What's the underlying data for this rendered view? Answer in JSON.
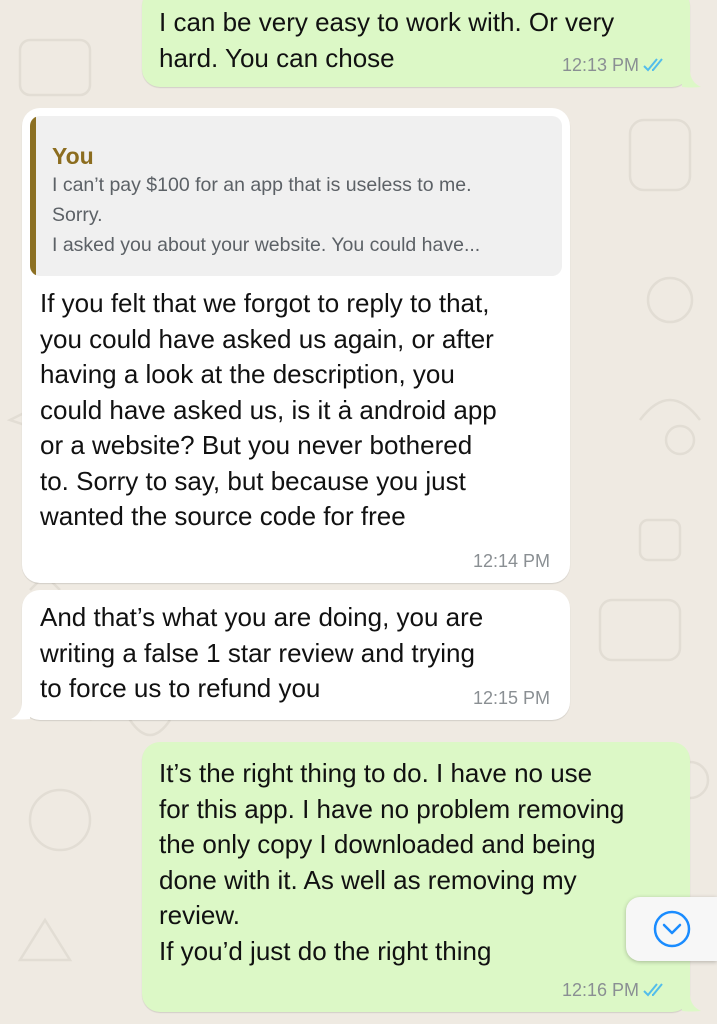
{
  "messages": [
    {
      "direction": "outgoing",
      "text": "I can be very easy to work with. Or very\nhard. You can chose",
      "time": "12:13 PM",
      "status": "read"
    },
    {
      "direction": "incoming",
      "quote": {
        "author": "You",
        "text": "I can’t pay $100 for an app that is useless to me.\nSorry.\nI asked you about your website. You could have..."
      },
      "text": "If you felt that we forgot to reply to that,\nyou could have asked us again, or after\nhaving a look at the description, you\ncould have asked us, is it ȧ android app\nor a website? But you never bothered\nto. Sorry to say, but because you just\nwanted the source code for free",
      "time": "12:14 PM"
    },
    {
      "direction": "incoming",
      "text": "And that’s what you are doing, you are\nwriting a false 1  star review and trying\nto force us to refund you",
      "time": "12:15 PM"
    },
    {
      "direction": "outgoing",
      "text": "It’s the right thing to do. I have no use\nfor this app. I have no problem removing\nthe only copy I downloaded and being\ndone with it. As well as removing my\nreview.\nIf you’d just do the right thing",
      "time": "12:16 PM",
      "status": "read"
    }
  ],
  "icons": {
    "read_receipt": "double-check-icon",
    "scroll_down": "chevron-down-circle-icon"
  },
  "colors": {
    "outgoing_bubble": "#dcf8c6",
    "incoming_bubble": "#ffffff",
    "chat_background": "#efeae2",
    "read_ticks": "#53bdeb",
    "quote_accent": "#8c6d1f",
    "scroll_icon": "#1a8cff"
  }
}
